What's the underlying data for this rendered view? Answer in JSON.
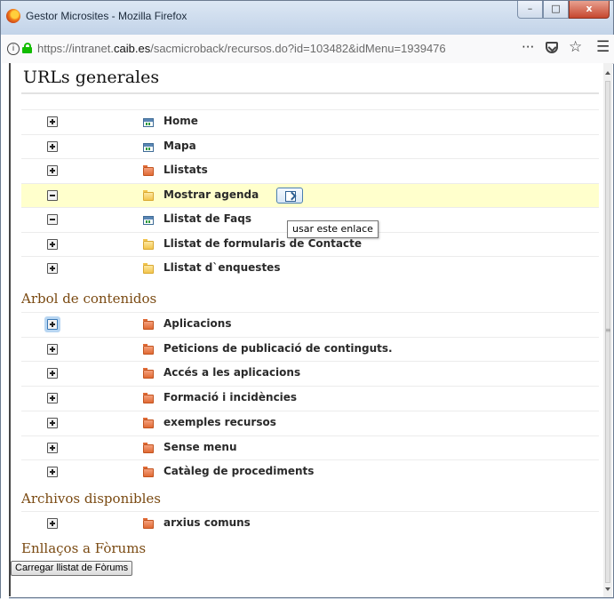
{
  "window": {
    "title": "Gestor Microsites - Mozilla Firefox",
    "controls": {
      "minimize": "–",
      "maximize": "□",
      "close": "x"
    }
  },
  "urlbar": {
    "url_prefix": "https://intranet.",
    "url_host": "caib.es",
    "url_path": "/sacmicroback/recursos.do?id=103482&idMenu=1939476",
    "more": "···",
    "star": "☆",
    "menu": "☰",
    "info": "i"
  },
  "page": {
    "title": "URLs generales",
    "tooltip": "usar este enlace",
    "forum_button": "Carregar llistat de Fòrums"
  },
  "urls_generales": [
    {
      "label": "Home",
      "icon": "page-icon",
      "expander": "plus"
    },
    {
      "label": "Mapa",
      "icon": "page-icon",
      "expander": "plus"
    },
    {
      "label": "Llistats",
      "icon": "folder-icon",
      "expander": "plus"
    },
    {
      "label": "Mostrar agenda",
      "icon": "yellow-folder-icon",
      "expander": "minus",
      "highlighted": true
    },
    {
      "label": "Llistat de Faqs",
      "icon": "page-icon",
      "expander": "minus"
    },
    {
      "label": "Llistat de formularis de Contacte",
      "icon": "yellow-folder-icon",
      "expander": "plus"
    },
    {
      "label": "Llistat d`enquestes",
      "icon": "yellow-folder-icon",
      "expander": "plus"
    }
  ],
  "arbol": {
    "title": "Arbol de contenidos",
    "items": [
      {
        "label": "Aplicacions",
        "icon": "folder-icon",
        "expander": "plus"
      },
      {
        "label": "Peticions de publicació de continguts.",
        "icon": "folder-icon",
        "expander": "plus"
      },
      {
        "label": "Accés a les aplicacions",
        "icon": "folder-icon",
        "expander": "plus"
      },
      {
        "label": "Formació i incidències",
        "icon": "folder-icon",
        "expander": "plus"
      },
      {
        "label": "exemples recursos",
        "icon": "folder-icon",
        "expander": "plus"
      },
      {
        "label": "Sense menu",
        "icon": "folder-icon",
        "expander": "plus"
      },
      {
        "label": "Catàleg de procediments",
        "icon": "folder-icon",
        "expander": "plus"
      }
    ]
  },
  "archivos": {
    "title": "Archivos disponibles",
    "items": [
      {
        "label": "arxius comuns",
        "icon": "folder-icon",
        "expander": "plus"
      }
    ]
  },
  "forums": {
    "title": "Enllaços a Fòrums"
  }
}
